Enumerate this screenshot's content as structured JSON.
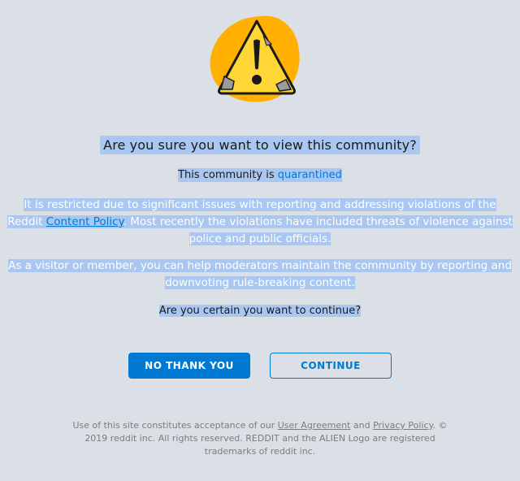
{
  "icons": {
    "warning": "warning-triangle-icon",
    "warning_fill": "#ffd635",
    "warning_blob": "#ffb000"
  },
  "colors": {
    "background": "#dae0e6",
    "primary": "#0079d3",
    "selection": "#a9c7f0"
  },
  "headline": "Are you sure you want to view this community?",
  "subtitle": {
    "prefix": "This community is ",
    "status": "quarantined"
  },
  "reason": {
    "part1": "It is restricted due to significant issues with reporting and addressing violations of the Reddit",
    "link": "Content Policy",
    "part2": ". Most recently the violations have included threats of violence against police and public officials."
  },
  "help_text": "As a visitor or member, you can help moderators maintain the community by reporting and downvoting rule-breaking content.",
  "question": "Are you certain you want to continue?",
  "buttons": {
    "decline": "NO THANK YOU",
    "continue": "CONTINUE"
  },
  "footer": {
    "text1": "Use of this site constitutes acceptance of our ",
    "user_agreement": "User Agreement",
    "and": " and ",
    "privacy_policy": "Privacy Policy",
    "text2": ". © 2019 reddit inc. All rights reserved. REDDIT and the ALIEN Logo are registered trademarks of reddit inc."
  }
}
